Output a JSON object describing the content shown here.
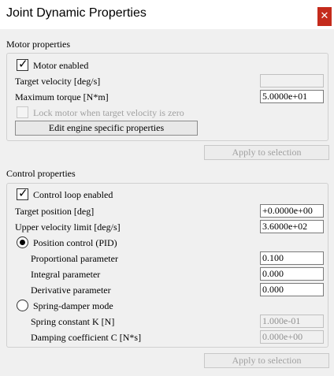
{
  "window": {
    "title": "Joint Dynamic Properties",
    "close_glyph": "✕"
  },
  "motor": {
    "section_label": "Motor properties",
    "motor_enabled_label": "Motor enabled",
    "motor_enabled_checked": true,
    "target_velocity_label": "Target velocity [deg/s]",
    "target_velocity_value": "",
    "max_torque_label": "Maximum torque [N*m]",
    "max_torque_value": "5.0000e+01",
    "lock_motor_label": "Lock motor when target velocity is zero",
    "lock_motor_checked": false,
    "edit_engine_button": "Edit engine specific properties",
    "apply_button": "Apply to selection"
  },
  "control": {
    "section_label": "Control properties",
    "control_loop_label": "Control loop enabled",
    "control_loop_checked": true,
    "target_position_label": "Target position [deg]",
    "target_position_value": "+0.0000e+00",
    "upper_velocity_label": "Upper velocity limit [deg/s]",
    "upper_velocity_value": "3.6000e+02",
    "position_control_label": "Position control (PID)",
    "position_control_selected": true,
    "proportional_label": "Proportional parameter",
    "proportional_value": "0.100",
    "integral_label": "Integral parameter",
    "integral_value": "0.000",
    "derivative_label": "Derivative parameter",
    "derivative_value": "0.000",
    "spring_damper_label": "Spring-damper mode",
    "spring_damper_selected": false,
    "spring_constant_label": "Spring constant K [N]",
    "spring_constant_value": "1.000e-01",
    "damping_label": "Damping coefficient C [N*s]",
    "damping_value": "0.000e+00",
    "apply_button": "Apply to selection"
  }
}
